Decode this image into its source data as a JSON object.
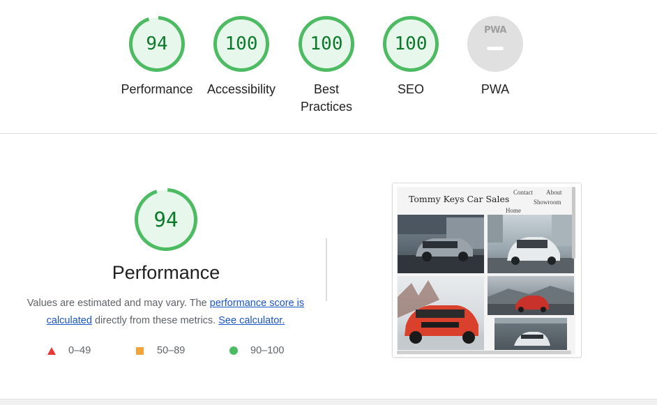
{
  "categories": [
    {
      "key": "performance",
      "label": "Performance",
      "score": "94",
      "fraction": 0.94
    },
    {
      "key": "accessibility",
      "label": "Accessibility",
      "score": "100",
      "fraction": 1.0
    },
    {
      "key": "best_practices",
      "label": "Best Practices",
      "score": "100",
      "fraction": 1.0
    },
    {
      "key": "seo",
      "label": "SEO",
      "score": "100",
      "fraction": 1.0
    }
  ],
  "pwa": {
    "badge_text": "PWA",
    "label": "PWA"
  },
  "performance_section": {
    "score": "94",
    "fraction": 0.94,
    "title": "Performance",
    "desc_before": "Values are estimated and may vary. The ",
    "link_score": "performance score is calculated",
    "desc_middle": " directly from these metrics. ",
    "link_calc": "See calculator."
  },
  "legend": [
    {
      "range": "0–49",
      "color": "#e53935",
      "icon": "red-triangle-icon"
    },
    {
      "range": "50–89",
      "color": "#f2a33a",
      "icon": "orange-square-icon"
    },
    {
      "range": "90–100",
      "color": "#4cbb62",
      "icon": "green-circle-icon"
    }
  ],
  "screenshot": {
    "site_title": "Tommy Keys Car Sales",
    "nav": {
      "contact": "Contact",
      "about": "About",
      "showroom": "Showroom",
      "home": "Home"
    }
  },
  "colors": {
    "pass_green": "#0a7a2a",
    "gauge_ring": "#4cbb62",
    "gauge_fill": "#e8f7eb",
    "link": "#1a55c9"
  }
}
